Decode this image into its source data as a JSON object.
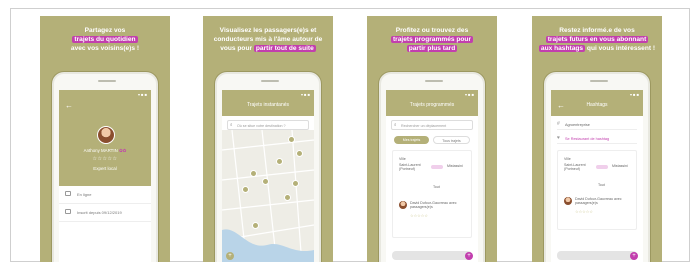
{
  "colors": {
    "olive": "#b4b078",
    "magenta": "#c23fae"
  },
  "panels": [
    {
      "caption_pre": "Partagez vos",
      "caption_hl": "trajets du quotidien",
      "caption_post": "avec vos voisins(e)s !",
      "screen_title": "",
      "profile": {
        "name": "Anthony MARTIN",
        "badge": "✿✿",
        "stars": "☆☆☆☆☆",
        "role": "Expert local"
      },
      "rows": [
        "En ligne",
        "Inscrit depuis 09/12/2019"
      ],
      "nav_icons": [
        "pin-icon",
        "circle-icon",
        "route-icon",
        "chat-icon",
        "grid-icon"
      ]
    },
    {
      "caption_pre": "Visualisez les passagers(e)s et conducteurs mis à l'âme autour de vous pour",
      "caption_hl": "partir tout de suite",
      "caption_post": "",
      "screen_title": "Trajets instantanés",
      "search_placeholder": "Où se situe votre destination ?",
      "nav_icons": [
        "pin-icon",
        "circle-icon",
        "route-icon",
        "chat-icon",
        "grid-icon"
      ]
    },
    {
      "caption_pre": "Profitez ou trouvez des",
      "caption_hl_line2": "trajets programmés pour",
      "caption_hl": "partir plus tard",
      "caption_post": "",
      "screen_title": "Trajets programmés",
      "search_placeholder": "Rechercher un déplacement",
      "tabs": [
        "Mes trajets",
        "Tous trajets"
      ],
      "trip": {
        "from_label": "Ville",
        "from": "Saint-Laurent (Portneuf)",
        "to": "Mistassini",
        "time_label": "Tout",
        "driver": "David Dufour-Gauvreau avec passagers(e)s",
        "stars": "☆☆☆☆☆"
      },
      "nav_icons": [
        "pin-icon",
        "circle-icon",
        "route-icon",
        "chat-icon",
        "grid-icon"
      ]
    },
    {
      "caption_pre": "Restez informé.e de vos",
      "caption_hl_line2": "trajets futurs en vous abonnant",
      "caption_hl": "aux hashtags",
      "caption_post": "qui vous intéressent !",
      "screen_title": "Hashtags",
      "list": [
        "Agroentreprise",
        "Se Restaurant de hashtag"
      ],
      "trip": {
        "from_label": "Ville",
        "from": "Saint-Laurent (Portneuf)",
        "to": "Mistassini",
        "time_label": "Tout",
        "driver": "David Dufour-Gauvreau avec passagers(e)s",
        "stars": "☆☆☆☆☆"
      },
      "nav_icons": [
        "pin-icon",
        "circle-icon",
        "route-icon",
        "chat-icon",
        "grid-icon"
      ]
    }
  ]
}
